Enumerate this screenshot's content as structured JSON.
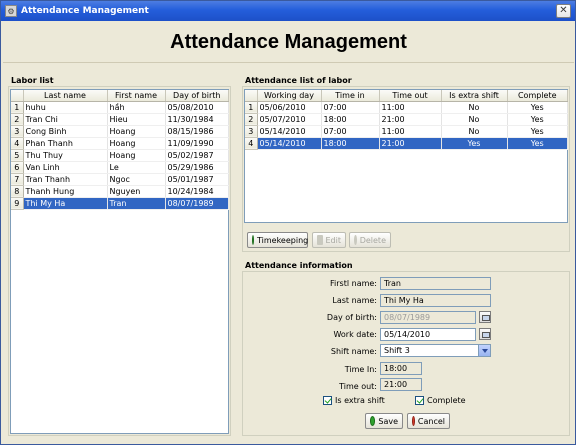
{
  "window": {
    "title": "Attendance Management",
    "heading": "Attendance Management"
  },
  "labor": {
    "title": "Labor list",
    "columns": [
      "Last name",
      "First name",
      "Day of birth"
    ],
    "rows": [
      {
        "n": "1",
        "last": "huhu",
        "first": "hầh",
        "dob": "05/08/2010"
      },
      {
        "n": "2",
        "last": "Tran Chi",
        "first": "Hieu",
        "dob": "11/30/1984"
      },
      {
        "n": "3",
        "last": "Cong Binh",
        "first": "Hoang",
        "dob": "08/15/1986"
      },
      {
        "n": "4",
        "last": "Phan Thanh",
        "first": "Hoang",
        "dob": "11/09/1990"
      },
      {
        "n": "5",
        "last": "Thu Thuy",
        "first": "Hoang",
        "dob": "05/02/1987"
      },
      {
        "n": "6",
        "last": "Van Linh",
        "first": "Le",
        "dob": "05/29/1986"
      },
      {
        "n": "7",
        "last": "Tran Thanh",
        "first": "Ngoc",
        "dob": "05/01/1987"
      },
      {
        "n": "8",
        "last": "Thanh Hung",
        "first": "Nguyen",
        "dob": "10/24/1984"
      },
      {
        "n": "9",
        "last": "Thi My Ha",
        "first": "Tran",
        "dob": "08/07/1989"
      }
    ],
    "selected_row": 8
  },
  "attendance": {
    "title": "Attendance list of labor",
    "columns": [
      "Working day",
      "Time in",
      "Time out",
      "Is extra shift",
      "Complete"
    ],
    "rows": [
      {
        "n": "1",
        "day": "05/06/2010",
        "tin": "07:00",
        "tout": "11:00",
        "extra": "No",
        "complete": "Yes"
      },
      {
        "n": "2",
        "day": "05/07/2010",
        "tin": "18:00",
        "tout": "21:00",
        "extra": "No",
        "complete": "Yes"
      },
      {
        "n": "3",
        "day": "05/14/2010",
        "tin": "07:00",
        "tout": "11:00",
        "extra": "No",
        "complete": "Yes"
      },
      {
        "n": "4",
        "day": "05/14/2010",
        "tin": "18:00",
        "tout": "21:00",
        "extra": "Yes",
        "complete": "Yes"
      }
    ],
    "selected_row": 3,
    "buttons": {
      "timekeeping": "Timekeeping",
      "edit": "Edit",
      "delete": "Delete"
    }
  },
  "info": {
    "title": "Attendance information",
    "first_name_label": "Firstl name:",
    "first_name": "Tran",
    "last_name_label": "Last name:",
    "last_name": "Thi My Ha",
    "dob_label": "Day of birth:",
    "dob": "08/07/1989",
    "work_date_label": "Work date:",
    "work_date": "05/14/2010",
    "shift_label": "Shift name:",
    "shift": "Shift 3",
    "time_in_label": "Time In:",
    "time_in": "18:00",
    "time_out_label": "Time out:",
    "time_out": "21:00",
    "extra_label": "Is extra shift",
    "complete_label": "Complete",
    "save": "Save",
    "cancel": "Cancel"
  },
  "colors": {
    "selection": "#3166c3",
    "titlebar": "#245edb",
    "panel": "#ece9d8"
  }
}
